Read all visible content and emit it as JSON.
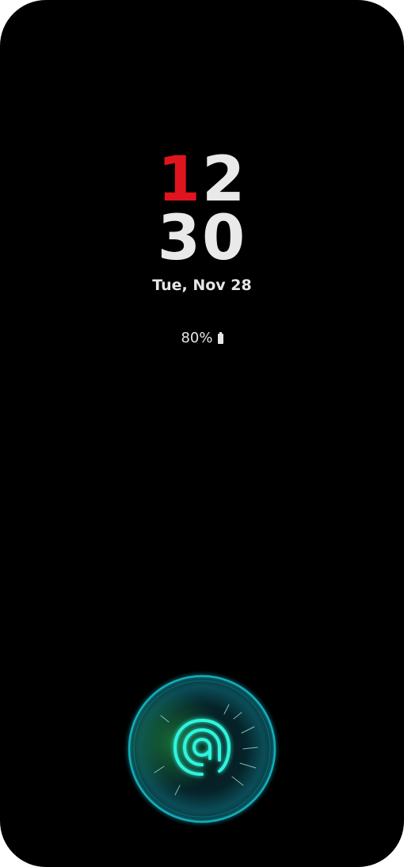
{
  "lockscreen": {
    "clock": {
      "hour_first_digit": "1",
      "hour_second_digit": "2",
      "minute": "30"
    },
    "date": "Tue, Nov 28",
    "battery": {
      "percent_text": "80%",
      "level": 0.8
    },
    "fingerprint": {
      "icon": "fingerprint-icon"
    }
  },
  "colors": {
    "background": "#000000",
    "clock_accent": "#e0141e",
    "text": "#e9e9e9",
    "fingerprint_glow": "#19e3d0"
  }
}
